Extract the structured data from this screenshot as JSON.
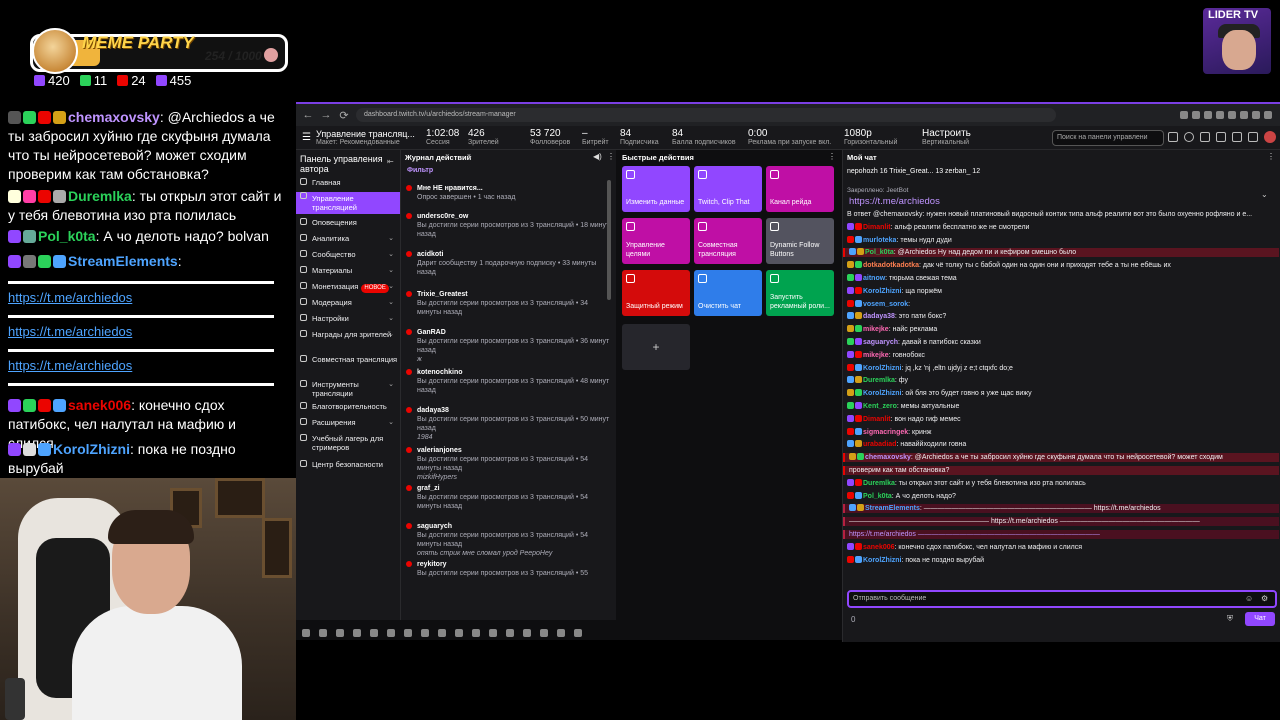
{
  "overlay": {
    "meme_party": {
      "title": "MEME PARTY",
      "count": "254 / 1000",
      "progress": 0.254
    },
    "stats": [
      {
        "icon": "viewers-icon",
        "value": "420",
        "color": "#9147ff"
      },
      {
        "icon": "followers-icon",
        "value": "11",
        "color": "#2bd25a"
      },
      {
        "icon": "live-icon",
        "value": "24",
        "color": "#eb0400"
      },
      {
        "icon": "subs-icon",
        "value": "455",
        "color": "#9147ff"
      }
    ],
    "messages": [
      {
        "name": "chemaxovsky",
        "name_color": "#bf94ff",
        "text": ": @Archiedos а че ты забросил хуйню где скуфыня думала что ты нейросетевой? может сходим проверим как там обстановка?"
      },
      {
        "name": "Duremlka",
        "name_color": "#2bd25a",
        "text": ": ты открыл этот сайт и у тебя блевотина изо рта полилась"
      },
      {
        "name": "Pol_k0ta",
        "name_color": "#2bd25a",
        "text": ": А чо делоть надо? bolvan"
      },
      {
        "name": "StreamElements",
        "name_color": "#4ea4ff",
        "text": ":"
      },
      {
        "name": "sanek006",
        "name_color": "#eb0400",
        "text": ": конечно сдох патибокс, чел налутал на мафию и слился"
      },
      {
        "name": "KorolZhizni",
        "name_color": "#4ea4ff",
        "text": ": пока не поздно вырубай"
      }
    ],
    "links": [
      "https://t.me/archiedos",
      "https://t.me/archiedos",
      "https://t.me/archiedos"
    ]
  },
  "lider": {
    "label": "LIDER TV"
  },
  "browser": {
    "url": "dashboard.twitch.tv/u/archiedos/stream-manager"
  },
  "topbar": {
    "title": "Управление трансляц...",
    "subtitle": "Макет: Рекомендованные",
    "metrics": [
      {
        "v": "1:02:08",
        "l": "Сессия"
      },
      {
        "v": "426",
        "l": "Зрителей"
      },
      {
        "v": "53 720",
        "l": "Фолловеров"
      },
      {
        "v": "–",
        "l": "Битрейт"
      },
      {
        "v": "84",
        "l": "Подписчика"
      },
      {
        "v": "84",
        "l": "Балла подписчиков"
      },
      {
        "v": "0:00",
        "l": "Реклама при запуске вкл."
      },
      {
        "v": "1080p",
        "l": "Горизонтальный"
      },
      {
        "v": "Настроить",
        "l": "Вертикальный"
      }
    ],
    "search_placeholder": "Поиск на панели управлени"
  },
  "sidebar": {
    "header": "Панель управления автора",
    "items": [
      {
        "label": "Главная"
      },
      {
        "label": "Управление трансляцией",
        "active": true
      },
      {
        "label": "Оповещения"
      },
      {
        "label": "Аналитика",
        "chev": true
      },
      {
        "label": "Сообщество",
        "chev": true
      },
      {
        "label": "Материалы",
        "chev": true
      },
      {
        "label": "Монетизация",
        "chev": true,
        "badge": "НОВОЕ"
      },
      {
        "label": "Модерация",
        "chev": true
      },
      {
        "label": "Настройки",
        "chev": true
      },
      {
        "label": "Награды для зрителей",
        "chev": true
      },
      {
        "label": "Совместная трансляция"
      },
      {
        "label": "Инструменты трансляции",
        "chev": true
      },
      {
        "label": "Благотворительность"
      },
      {
        "label": "Расширения",
        "chev": true
      },
      {
        "label": "Учебный лагерь для стримеров"
      },
      {
        "label": "Центр безопасности"
      }
    ]
  },
  "activity": {
    "header": "Журнал действий",
    "filter": "Фильтр",
    "items": [
      {
        "name": "Мне НЕ нравится...",
        "desc": "Опрос завершен • 1 час назад",
        "quote": ""
      },
      {
        "name": "undersc0re_ow",
        "desc": "Вы достигли серии просмотров из 3 трансляций • 18 минут назад",
        "quote": ""
      },
      {
        "name": "acidkoti",
        "desc": "Дарит сообществу 1 подарочную подписку • 33 минуты назад",
        "quote": ""
      },
      {
        "name": "Trixie_Greatest",
        "desc": "Вы достигли серии просмотров из 3 трансляций • 34 минуты назад",
        "quote": ""
      },
      {
        "name": "GanRAD",
        "desc": "Вы достигли серии просмотров из 3 трансляций • 36 минут назад",
        "quote": "ж"
      },
      {
        "name": "kotenochkino",
        "desc": "Вы достигли серии просмотров из 3 трансляций • 48 минут назад",
        "quote": ""
      },
      {
        "name": "dadaya38",
        "desc": "Вы достигли серии просмотров из 3 трансляций • 50 минут назад",
        "quote": "1984"
      },
      {
        "name": "valerianjones",
        "desc": "Вы достигли серии просмотров из 3 трансляций • 54 минуты назад",
        "quote": "mizkifHypers"
      },
      {
        "name": "graf_zi",
        "desc": "Вы достигли серии просмотров из 3 трансляций • 54 минуты назад",
        "quote": ""
      },
      {
        "name": "saguarych",
        "desc": "Вы достигли серии просмотров из 3 трансляций • 54 минуты назад",
        "quote": "опять стрик мне сломал урод PeepoHey"
      },
      {
        "name": "reykitory",
        "desc": "Вы достигли серии просмотров из 3 трансляций • 55",
        "quote": ""
      }
    ]
  },
  "quick": {
    "header": "Быстрые действия",
    "tiles": [
      {
        "label": "Изменить данные",
        "color": "#9147ff"
      },
      {
        "label": "Twitch, Clip That",
        "color": "#9147ff"
      },
      {
        "label": "Канал рейда",
        "color": "#bf0fa5"
      },
      {
        "label": "Управление целями",
        "color": "#bf0fa5"
      },
      {
        "label": "Совместная трансляция",
        "color": "#bf0fa5"
      },
      {
        "label": "Dynamic Follow Buttons",
        "color": "#53535f"
      },
      {
        "label": "Защитный режим",
        "color": "#d40b0b"
      },
      {
        "label": "Очистить чат",
        "color": "#2f7dea"
      },
      {
        "label": "Запустить рекламный роли...",
        "color": "#00a34f"
      }
    ],
    "add": "+"
  },
  "chat": {
    "header": "Мой чат",
    "top_bar": "nepohozh 16   Trixie_Great... 13   zerban_ 12",
    "pinned_label": "Закреплено: JeetBot",
    "pinned": "https://t.me/archiedos",
    "messages": [
      {
        "n": "",
        "c": "#efeff1",
        "t": "В ответ @chemaxovsky: нужен новый платиновый видосный контик типа альф реалити вот это было охуенно рофляно и е...",
        "hl": ""
      },
      {
        "n": "Dimanlit",
        "c": "#eb0400",
        "t": ": альф реалити бесплатно же не смотрели",
        "hl": ""
      },
      {
        "n": "murloteka",
        "c": "#4ea4ff",
        "t": ": темы нудл дуди",
        "hl": ""
      },
      {
        "n": "Pol_k0ta",
        "c": "#2bd25a",
        "t": ": @Archiedos Ну над дедом пи и кефиром смешно было",
        "hl": "hl"
      },
      {
        "n": "dotkadotkadotka",
        "c": "#ff7f50",
        "t": ": дак чё толку ты с бабой один на один они и приходят тебе а ты не ебёшь их",
        "hl": ""
      },
      {
        "n": "aitnow",
        "c": "#4ea4ff",
        "t": ": тюрьма свежая тема",
        "hl": ""
      },
      {
        "n": "KorolZhizni",
        "c": "#4ea4ff",
        "t": ": ща поржём",
        "hl": ""
      },
      {
        "n": "vosem_sorok",
        "c": "#4ea4ff",
        "t": ":",
        "hl": ""
      },
      {
        "n": "dadaya38",
        "c": "#bf94ff",
        "t": ": это пати бокс?",
        "hl": ""
      },
      {
        "n": "mikejke",
        "c": "#ff69b4",
        "t": ": найс реклама",
        "hl": ""
      },
      {
        "n": "saguarych",
        "c": "#bf94ff",
        "t": ": давай в патибокс сказки",
        "hl": ""
      },
      {
        "n": "mikejke",
        "c": "#ff69b4",
        "t": ": говнобокс",
        "hl": ""
      },
      {
        "n": "KorolZhizni",
        "c": "#4ea4ff",
        "t": ": jq ,kz 'nj ,eltn ujdyj z e;t ctqxfc do;e",
        "hl": ""
      },
      {
        "n": "Duremlka",
        "c": "#2bd25a",
        "t": ": фу",
        "hl": ""
      },
      {
        "n": "KorolZhizni",
        "c": "#4ea4ff",
        "t": ": ой бля это будет говно я уже щас вижу",
        "hl": ""
      },
      {
        "n": "Kent_zero",
        "c": "#2bd25a",
        "t": ": мемы актуальные",
        "hl": ""
      },
      {
        "n": "Dimanlit",
        "c": "#eb0400",
        "t": ": вон надо гиф мемес",
        "hl": ""
      },
      {
        "n": "sigmacringek",
        "c": "#ff69b4",
        "t": ": кринж",
        "hl": ""
      },
      {
        "n": "urabadiad",
        "c": "#eb0400",
        "t": ": наваййходили говна",
        "hl": ""
      },
      {
        "n": "chemaxovsky",
        "c": "#bf94ff",
        "t": ": @Archiedos а че ты забросил хуйню где скуфыня думала что ты нейросетевой? может сходим",
        "hl": "hl"
      },
      {
        "n": "",
        "c": "#efeff1",
        "t": "проверим как там обстановка?",
        "hl": "hl"
      },
      {
        "n": "Duremlka",
        "c": "#2bd25a",
        "t": ": ты открыл этот сайт и у тебя блевотина изо рта полилась",
        "hl": ""
      },
      {
        "n": "Pol_k0ta",
        "c": "#2bd25a",
        "t": ": А чо делоть надо?",
        "hl": ""
      },
      {
        "n": "StreamElements",
        "c": "#4ea4ff",
        "t": ": ———————————————————————— https://t.me/archiedos",
        "hl": "hl2"
      },
      {
        "n": "",
        "c": "#efeff1",
        "t": "———————————————————— https://t.me/archiedos ————————————————————",
        "hl": "hl2"
      },
      {
        "n": "",
        "c": "#bf94ff",
        "t": "https://t.me/archiedos ——————————————————————————",
        "hl": "hl2"
      },
      {
        "n": "sanek006",
        "c": "#eb0400",
        "t": ": конечно сдох патибокс, чел налутал на мафию и слился",
        "hl": ""
      },
      {
        "n": "KorolZhizni",
        "c": "#4ea4ff",
        "t": ": пока не поздно вырубай",
        "hl": ""
      }
    ],
    "send_placeholder": "Отправить сообщение",
    "send_button": "Чат",
    "points": "0"
  }
}
